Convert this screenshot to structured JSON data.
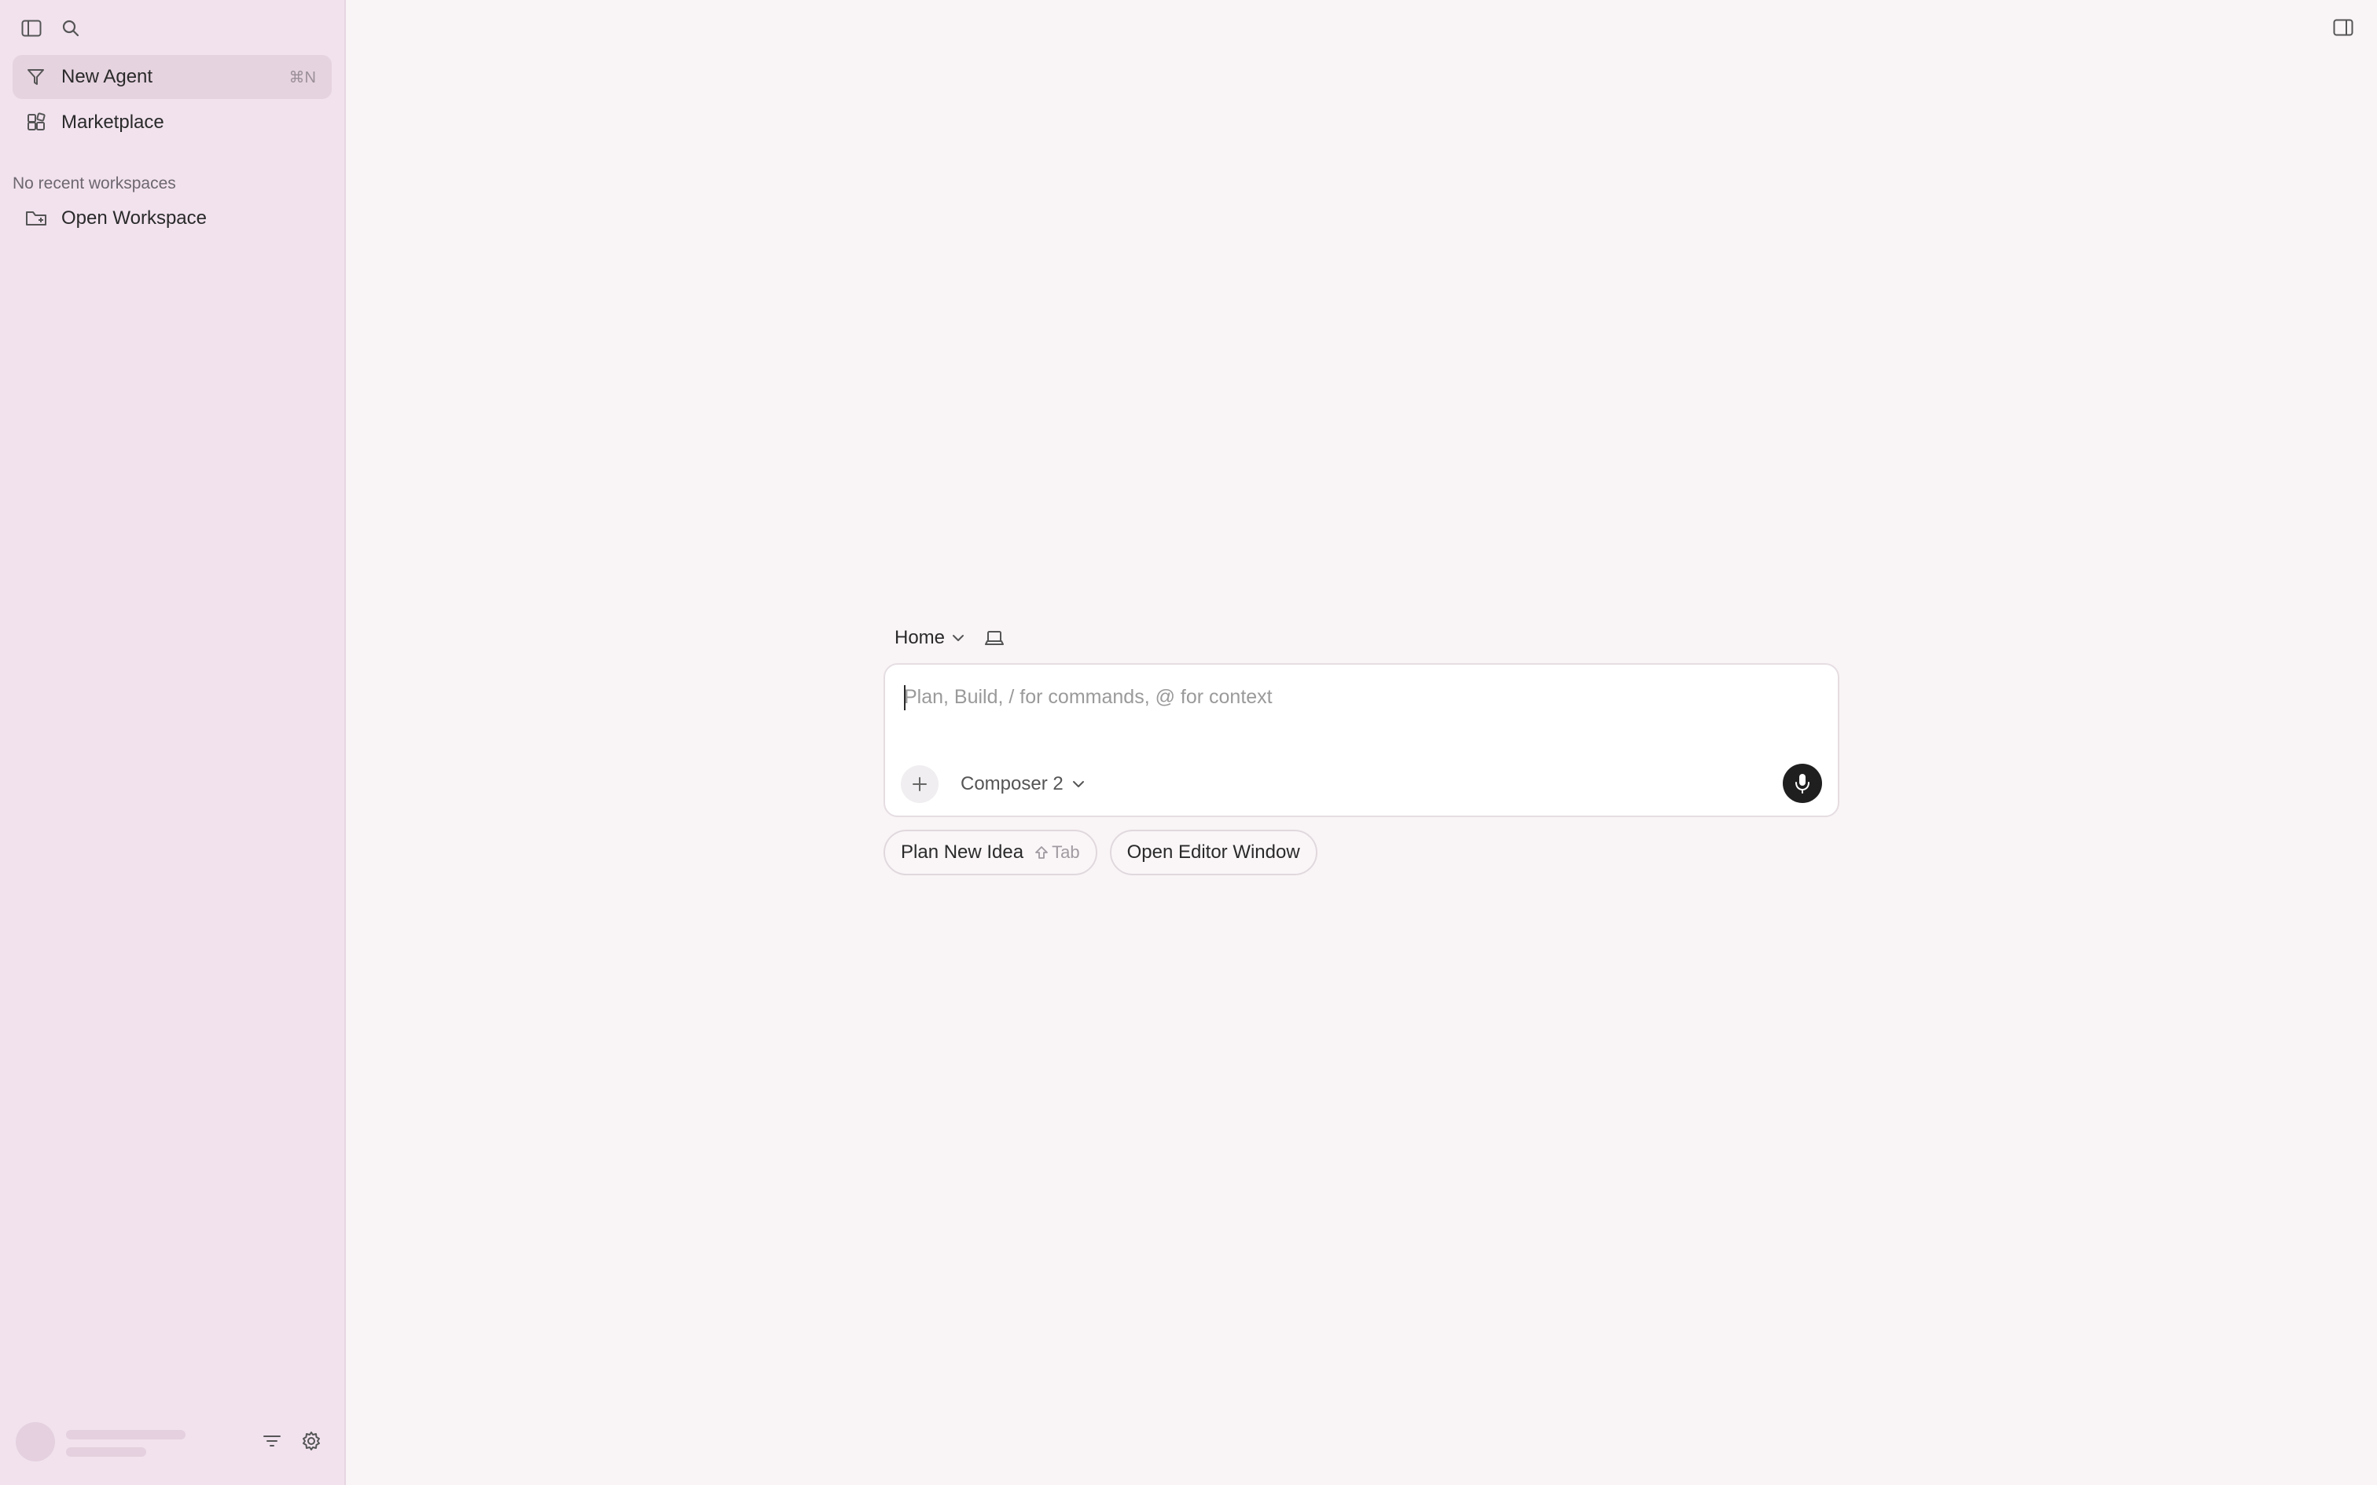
{
  "sidebar": {
    "nav_items": [
      {
        "label": "New Agent",
        "icon": "agent-icon",
        "shortcut": "⌘N",
        "active": true
      },
      {
        "label": "Marketplace",
        "icon": "marketplace-icon"
      }
    ],
    "section_label": "No recent workspaces",
    "open_workspace_label": "Open Workspace"
  },
  "composer": {
    "location_label": "Home",
    "input_placeholder": "Plan, Build, / for commands, @ for context",
    "model_label": "Composer 2"
  },
  "actions": {
    "plan_label": "Plan New Idea",
    "plan_shortcut": "Tab",
    "open_editor_label": "Open Editor Window"
  },
  "colors": {
    "sidebar_bg": "#f1e2ee",
    "main_bg": "#f9f4f6",
    "mic_button": "#1f1f1f"
  }
}
